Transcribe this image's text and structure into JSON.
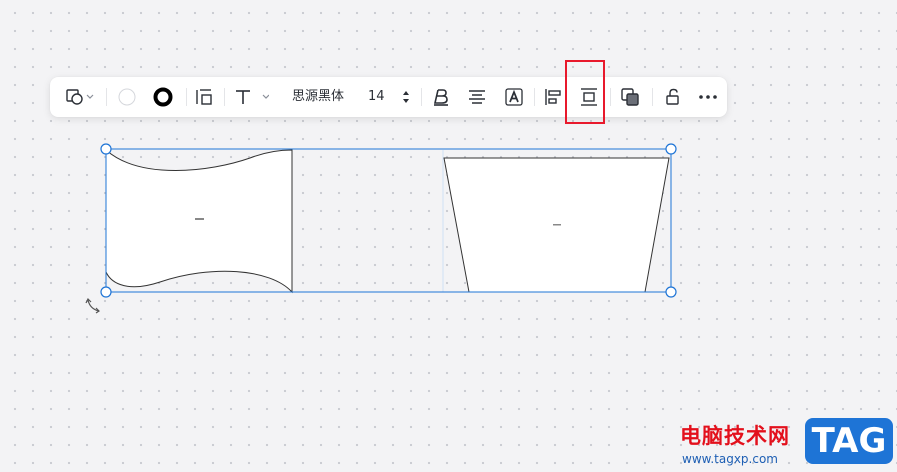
{
  "toolbar": {
    "font_name": "思源黑体",
    "font_size": "14",
    "icons": [
      "shape-type-icon",
      "chevron-down-icon",
      "fill-color-icon",
      "border-style-icon",
      "text-position-icon",
      "text-icon",
      "chevron-down-icon",
      "bold-icon",
      "align-center-icon",
      "text-color-icon",
      "align-left-icon",
      "distribute-vertical-icon",
      "layer-order-icon",
      "unlock-icon",
      "more-icon"
    ]
  },
  "highlight": {
    "target": "distribute-vertical-button",
    "color": "#e8192c"
  },
  "canvas": {
    "selection_color": "#1e74d6",
    "shapes": [
      {
        "name": "wave-flag-shape",
        "label": ""
      },
      {
        "name": "trapezoid-shape",
        "label": ""
      }
    ]
  },
  "watermark": {
    "site_name": "电脑技术网",
    "url": "www.tagxp.com",
    "tag": "TAG"
  }
}
